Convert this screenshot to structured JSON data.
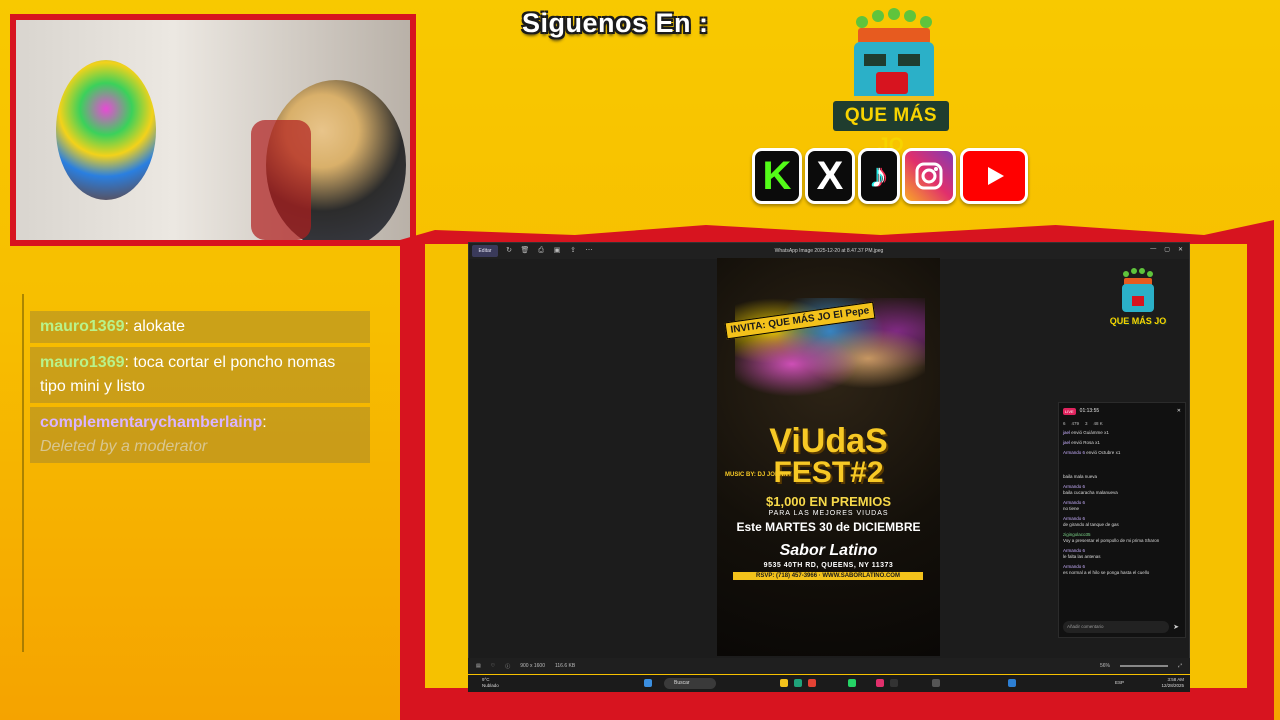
{
  "follow": {
    "title": "Siguenos En :",
    "logo_text": "QUE MÁS JO"
  },
  "social_icons": [
    "kick-icon",
    "x-icon",
    "tiktok-icon",
    "instagram-icon",
    "youtube-icon"
  ],
  "chat": {
    "messages": [
      {
        "user": "mauro1369",
        "text": "alokate",
        "user_color": "#b9f28a"
      },
      {
        "user": "mauro1369",
        "text": "toca cortar el poncho nomas tipo mini y listo",
        "user_color": "#b9f28a"
      },
      {
        "user": "complementarychamberlainp",
        "text": "Deleted by a moderator",
        "user_color": "#d9b4ff"
      }
    ]
  },
  "viewer": {
    "edit_label": "Editar",
    "file_title": "WhatsApp Image 2025-12-20 at 8.47.37 PM.jpeg",
    "status_size": "900 x 1600",
    "status_bytes": "116.6 KB",
    "zoom": "56%"
  },
  "poster": {
    "invita": "INVITA: QUE MÁS JO El Pepe",
    "title": "ViUdaS",
    "subtitle": "FEST#2",
    "music": "MUSIC BY: DJ JOHNNY",
    "premios": "$1,000 EN PREMIOS",
    "para": "PARA LAS MEJORES VIUDAS",
    "date": "Este MARTES 30 de DICIEMBRE",
    "venue": "Sabor Latino",
    "address": "9535 40TH RD, QUEENS, NY 11373",
    "rsvp": "RSVP: (718) 457-3966 · WWW.SABORLATINO.COM"
  },
  "stream_chat": {
    "live_label": "LIVE",
    "timer": "01:13:55",
    "stats": [
      "6",
      "479",
      "3",
      "48 K"
    ],
    "gifts": [
      {
        "user": "jael",
        "text": "envió Guiámme",
        "count": "x1"
      },
      {
        "user": "jael",
        "text": "envió Rosa",
        "count": "x1"
      },
      {
        "user": "Armando 6",
        "text": "envió Octubre",
        "count": "x1"
      }
    ],
    "rows": [
      {
        "user": "",
        "text": "baila mala nueva"
      },
      {
        "user": "Armando 6",
        "text": "baila cucaracha malanueva"
      },
      {
        "user": "Armando 6",
        "text": "no tiene"
      },
      {
        "user": "Armando 6",
        "text": "de girando al tanque de gas"
      },
      {
        "user": "zigingolaco35",
        "text": "Voy a presentar el pompollo de mi prima Sharon"
      },
      {
        "user": "Armando 6",
        "text": "le falta las antenas"
      },
      {
        "user": "Armando 6",
        "text": "es normal a el hilo se ponga hasta el cuello"
      }
    ],
    "input_placeholder": "Añadir comentario"
  },
  "taskbar": {
    "weather_temp": "9°C",
    "weather_desc": "Nublado",
    "search_placeholder": "Buscar",
    "lang": "ESP",
    "time": "3:58 AM",
    "date": "12/28/2025"
  }
}
